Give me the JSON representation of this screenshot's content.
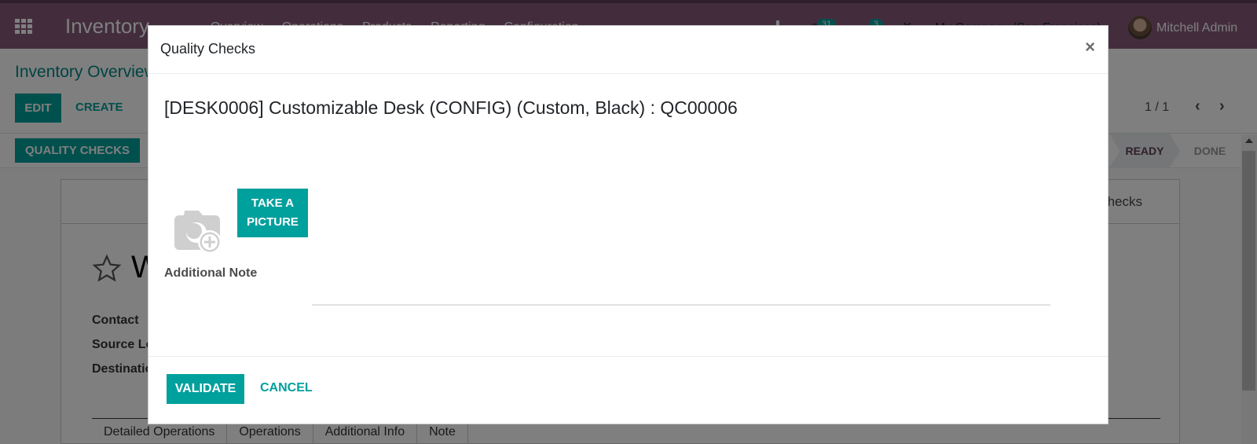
{
  "navbar": {
    "app_name": "Inventory",
    "menu": [
      "Overview",
      "Operations",
      "Products",
      "Reporting",
      "Configuration"
    ],
    "activity_count": "31",
    "message_count": "3",
    "company": "My Company (San Francisco)",
    "user": "Mitchell Admin"
  },
  "control_panel": {
    "breadcrumb": "Inventory Overview",
    "edit_label": "EDIT",
    "create_label": "CREATE",
    "pager": "1 / 1",
    "prev_icon": "‹",
    "next_icon": "›"
  },
  "statusbar": {
    "quality_checks_button": "QUALITY CHECKS",
    "stages": [
      "READY",
      "DONE"
    ],
    "active_stage": "READY"
  },
  "form": {
    "smart_button": "Quality Checks",
    "title_partial": "W",
    "fields": [
      "Contact",
      "Source Location",
      "Destination Location"
    ],
    "tabs": [
      "Detailed Operations",
      "Operations",
      "Additional Info",
      "Note"
    ]
  },
  "modal": {
    "title": "Quality Checks",
    "close_icon": "×",
    "product": "[DESK0006] Customizable Desk (CONFIG) (Custom, Black) : QC00006",
    "take_picture_line1": "TAKE A",
    "take_picture_line2": "PICTURE",
    "note_label": "Additional Note",
    "note_value": "",
    "validate_label": "VALIDATE",
    "cancel_label": "CANCEL"
  },
  "colors": {
    "brand": "#875a7b",
    "primary": "#00a09d",
    "breadcrumb": "#008784"
  }
}
